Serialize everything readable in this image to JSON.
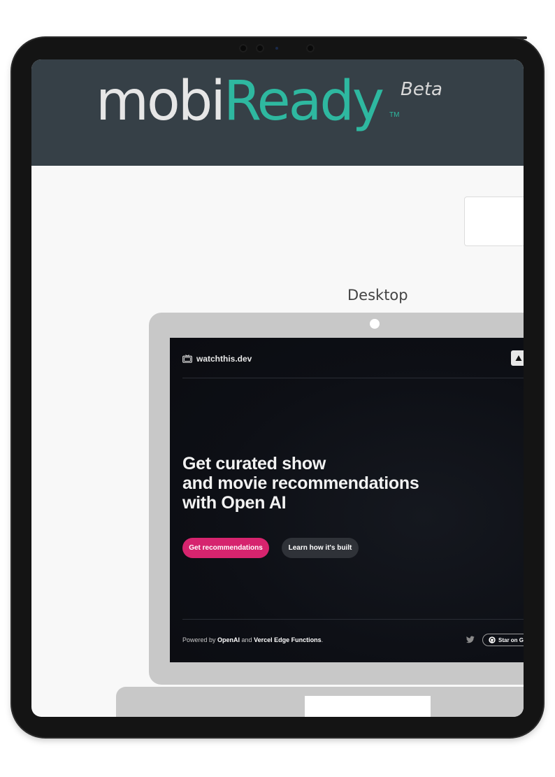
{
  "mobiready": {
    "logo_mobi": "mobi",
    "logo_ready": "Ready",
    "logo_tm": "TM",
    "logo_beta": "Beta",
    "device_label": "Desktop"
  },
  "site": {
    "brand": "watchthis.dev",
    "headline": [
      "Get curated show",
      "and movie recommendations",
      "with Open AI"
    ],
    "primary_button": "Get recommendations",
    "secondary_button": "Learn how it's built",
    "footer": {
      "powered_by": "Powered by ",
      "openai": "OpenAI",
      "and": " and ",
      "vercel": "Vercel Edge Functions",
      "period": "."
    },
    "star_button": "Star on G"
  },
  "colors": {
    "header_bg": "#364047",
    "logo_accent": "#2eb8a0",
    "primary_button": "#d6246e",
    "secondary_button": "#2f3238",
    "site_bg": "#0d0f15"
  },
  "icons": {
    "site_logo": "tv-icon",
    "theme_toggle": "triangle-icon",
    "social": "twitter-icon",
    "repo": "github-icon"
  }
}
